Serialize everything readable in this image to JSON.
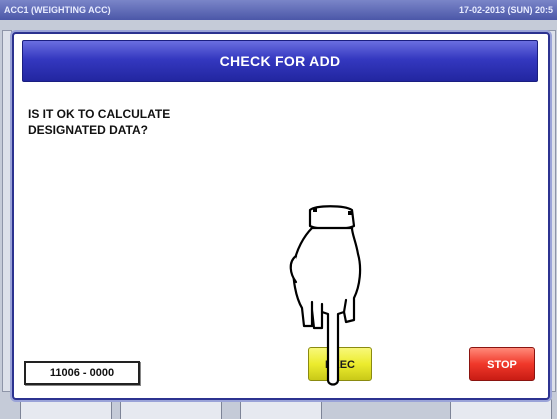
{
  "statusbar": {
    "title": "ACC1 (WEIGHTING ACC)",
    "datetime": "17-02-2013 (SUN)  20:5"
  },
  "dialog": {
    "title": "CHECK FOR ADD",
    "message_lines": [
      "IS IT OK TO CALCULATE",
      "DESIGNATED DATA?"
    ],
    "code": "11006 - 0000",
    "exec_label": "EXEC",
    "stop_label": "STOP"
  },
  "colors": {
    "header_blue": "#3438c0",
    "exec_yellow": "#ecec2e",
    "stop_red": "#f0382a"
  },
  "icons": {
    "pointer": "pointing-hand-icon"
  }
}
